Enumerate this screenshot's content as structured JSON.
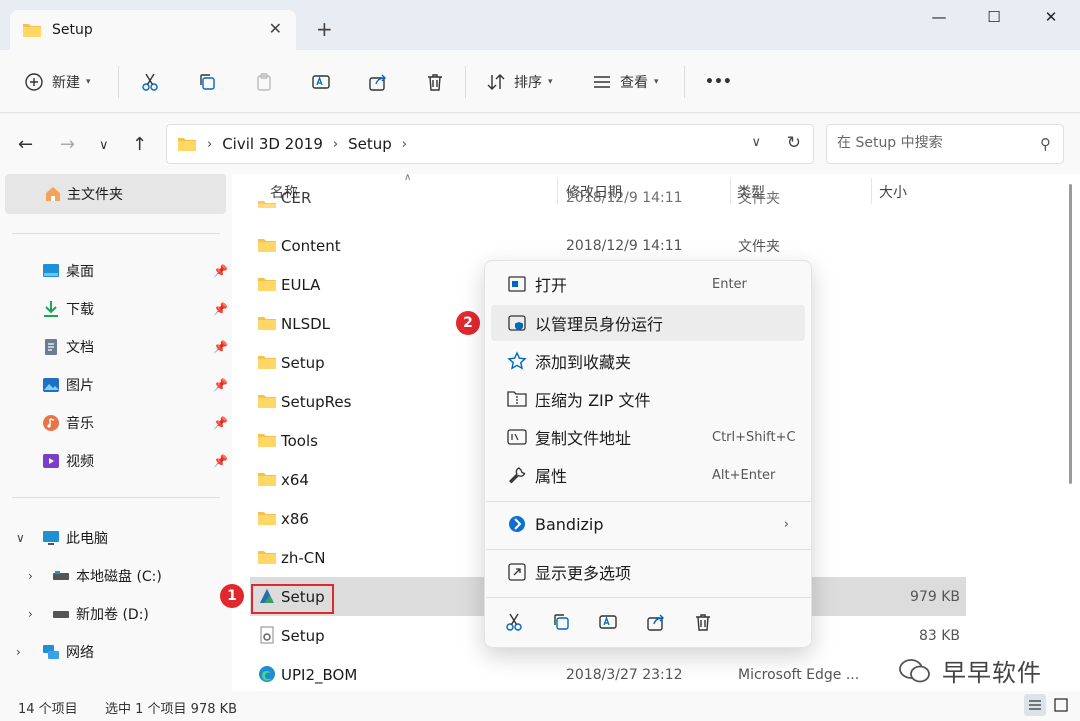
{
  "window": {
    "tab_title": "Setup",
    "tab_close": "✕",
    "new_tab": "+",
    "minimize": "—",
    "maximize": "☐",
    "close": "✕"
  },
  "toolbar": {
    "new_label": "新建",
    "sort_label": "排序",
    "view_label": "查看",
    "more_label": "•••"
  },
  "address": {
    "crumbs": [
      "Civil 3D 2019",
      "Setup"
    ],
    "search_placeholder": "在 Setup 中搜索"
  },
  "sidebar": {
    "home": "主文件夹",
    "pinned": [
      {
        "label": "桌面",
        "icon": "desktop-icon"
      },
      {
        "label": "下载",
        "icon": "download-icon"
      },
      {
        "label": "文档",
        "icon": "document-icon"
      },
      {
        "label": "图片",
        "icon": "picture-icon"
      },
      {
        "label": "音乐",
        "icon": "music-icon"
      },
      {
        "label": "视频",
        "icon": "video-icon"
      }
    ],
    "this_pc": "此电脑",
    "drives": [
      "本地磁盘 (C:)",
      "新加卷 (D:)"
    ],
    "network": "网络"
  },
  "columns": {
    "name": "名称",
    "date": "修改日期",
    "type": "类型",
    "size": "大小"
  },
  "files": [
    {
      "name": "CER",
      "date": "2018/12/9 14:11",
      "type": "文件夹",
      "size": "",
      "kind": "folder"
    },
    {
      "name": "Content",
      "date": "2018/12/9 14:11",
      "type": "文件夹",
      "size": "",
      "kind": "folder"
    },
    {
      "name": "EULA",
      "date": "",
      "type": "",
      "size": "",
      "kind": "folder"
    },
    {
      "name": "NLSDL",
      "date": "",
      "type": "",
      "size": "",
      "kind": "folder"
    },
    {
      "name": "Setup",
      "date": "",
      "type": "",
      "size": "",
      "kind": "folder"
    },
    {
      "name": "SetupRes",
      "date": "",
      "type": "",
      "size": "",
      "kind": "folder"
    },
    {
      "name": "Tools",
      "date": "",
      "type": "",
      "size": "",
      "kind": "folder"
    },
    {
      "name": "x64",
      "date": "",
      "type": "",
      "size": "",
      "kind": "folder"
    },
    {
      "name": "x86",
      "date": "",
      "type": "",
      "size": "",
      "kind": "folder"
    },
    {
      "name": "zh-CN",
      "date": "",
      "type": "",
      "size": "",
      "kind": "folder"
    },
    {
      "name": "Setup",
      "date": "",
      "type": "",
      "size": "979 KB",
      "kind": "exe"
    },
    {
      "name": "Setup",
      "date": "",
      "type": "",
      "size": "83 KB",
      "kind": "ini"
    },
    {
      "name": "UPI2_BOM",
      "date": "2018/3/27 23:12",
      "type": "Microsoft Edge ...",
      "size": "",
      "kind": "edge"
    }
  ],
  "context_menu": {
    "items": [
      {
        "label": "打开",
        "shortcut": "Enter",
        "icon": "open-icon"
      },
      {
        "label": "以管理员身份运行",
        "shortcut": "",
        "icon": "shield-icon"
      },
      {
        "label": "添加到收藏夹",
        "shortcut": "",
        "icon": "star-icon"
      },
      {
        "label": "压缩为 ZIP 文件",
        "shortcut": "",
        "icon": "zip-icon"
      },
      {
        "label": "复制文件地址",
        "shortcut": "Ctrl+Shift+C",
        "icon": "copy-path-icon"
      },
      {
        "label": "属性",
        "shortcut": "Alt+Enter",
        "icon": "wrench-icon"
      },
      {
        "label": "Bandizip",
        "shortcut": "",
        "icon": "bandizip-icon"
      },
      {
        "label": "显示更多选项",
        "shortcut": "",
        "icon": "more-options-icon"
      }
    ]
  },
  "annotations": {
    "badge1": "1",
    "badge2": "2"
  },
  "status": {
    "count": "14 个项目",
    "selection": "选中 1 个项目  978 KB"
  },
  "watermark": "早早软件",
  "colors": {
    "accent": "#0067c0",
    "folder": "#f4c04e",
    "highlight": "#e0282f"
  }
}
